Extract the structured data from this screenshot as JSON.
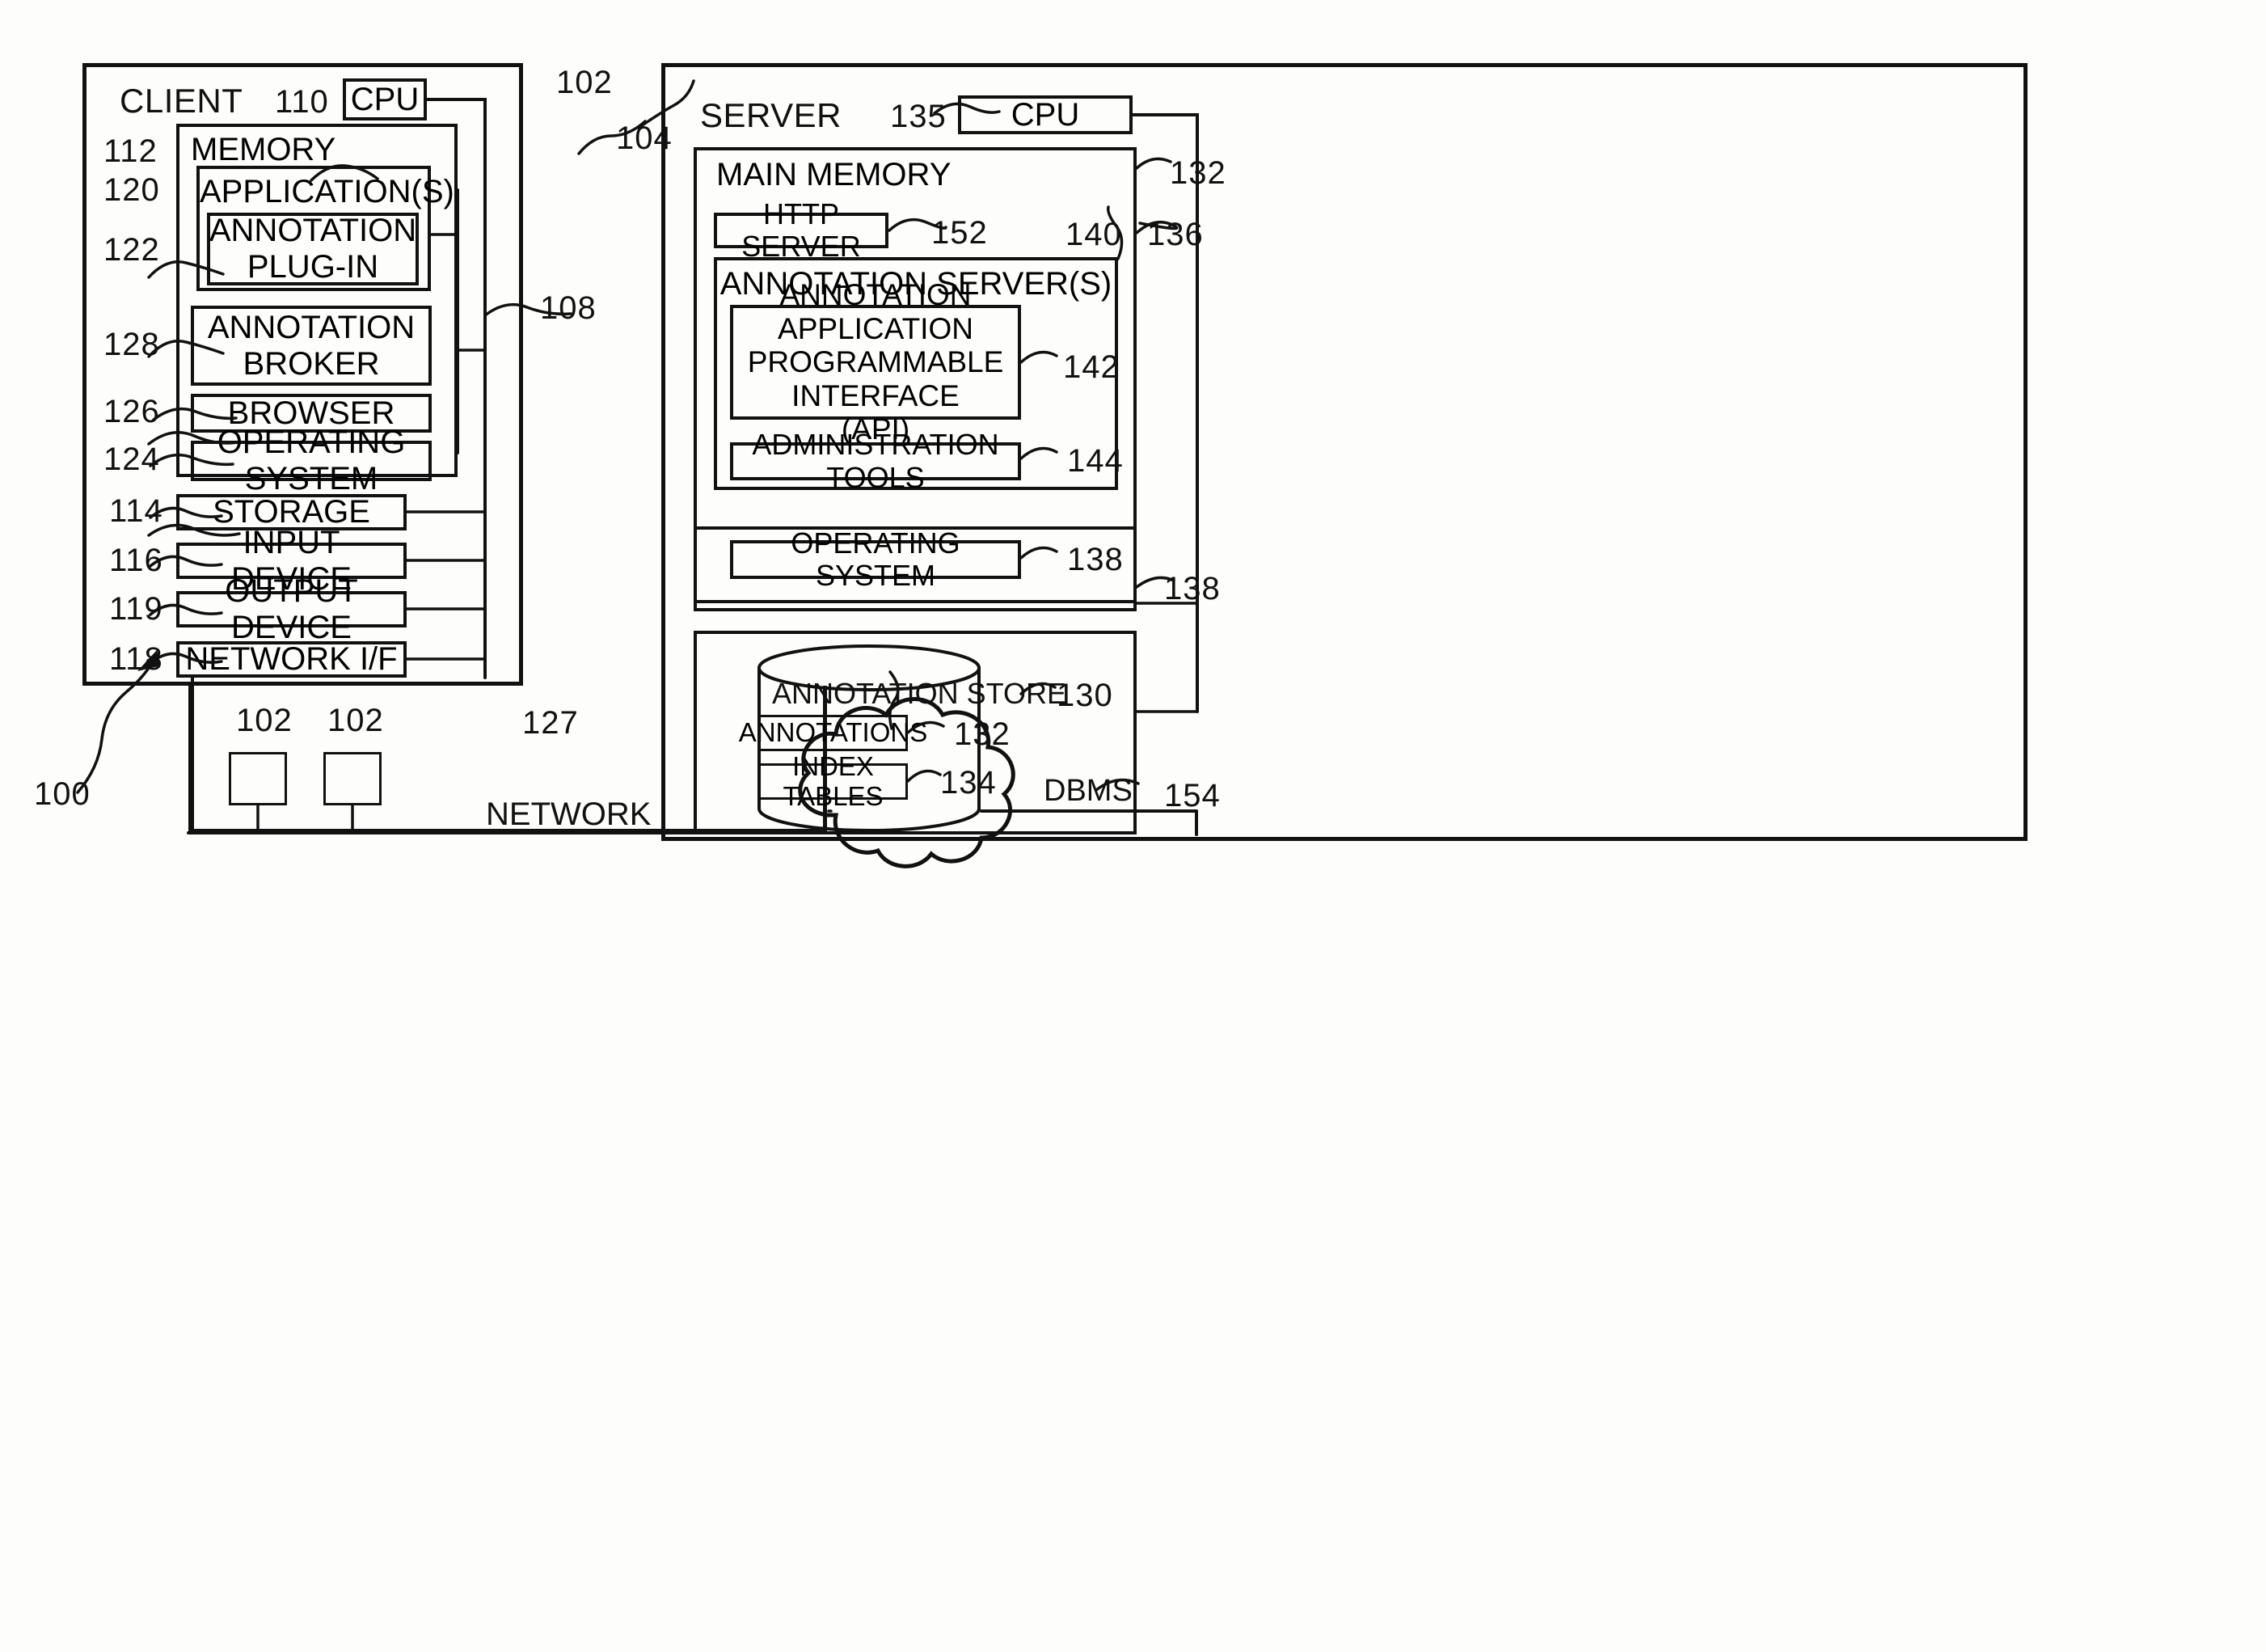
{
  "figure": {
    "system_ref": "100",
    "client": {
      "title": "CLIENT",
      "ref": "102",
      "bus_ref": "108",
      "cpu": {
        "label": "CPU",
        "ref": "110"
      },
      "memory": {
        "label": "MEMORY",
        "ref": "112"
      },
      "applications": {
        "label": "APPLICATION(S)",
        "ref": "120"
      },
      "annotation_plugin": {
        "line1": "ANNOTATION",
        "line2": "PLUG-IN",
        "ref": "122"
      },
      "annotation_broker": {
        "line1": "ANNOTATION",
        "line2": "BROKER",
        "ref": "128"
      },
      "browser": {
        "label": "BROWSER",
        "ref": "126"
      },
      "operating_system": {
        "label": "OPERATING SYSTEM",
        "ref": "124"
      },
      "storage": {
        "label": "STORAGE",
        "ref": "114"
      },
      "input_device": {
        "label": "INPUT DEVICE",
        "ref": "116"
      },
      "output_device": {
        "label": "OUTPUT DEVICE",
        "ref": "119"
      },
      "network_if": {
        "label": "NETWORK I/F",
        "ref": "118"
      }
    },
    "additional_clients": [
      {
        "ref": "102"
      },
      {
        "ref": "102"
      }
    ],
    "network": {
      "label": "NETWORK",
      "ref": "127"
    },
    "server": {
      "title": "SERVER",
      "ref": "104",
      "cpu": {
        "label": "CPU",
        "ref": "135"
      },
      "main_memory": {
        "label": "MAIN MEMORY",
        "ref": "132"
      },
      "bus_ref_upper": "136",
      "bus_ref_lower": "138",
      "http_server": {
        "label": "HTTP SERVER",
        "ref": "152"
      },
      "annotation_servers": {
        "label": "ANNOTATION SERVER(S)",
        "ref": "140"
      },
      "api": {
        "line1": "ANNOTATION APPLICATION",
        "line2": "PROGRAMMABLE INTERFACE",
        "line3": "(API)",
        "ref": "142"
      },
      "administration_tools": {
        "label": "ADMINISTRATION TOOLS",
        "ref": "144"
      },
      "operating_system": {
        "label": "OPERATING SYSTEM",
        "ref": "138"
      },
      "dbms": {
        "label": "DBMS",
        "ref": "154"
      },
      "annotation_store": {
        "label": "ANNOTATION STORE",
        "ref": "130"
      },
      "annotations": {
        "label": "ANNOTATIONS",
        "ref": "132"
      },
      "index_tables": {
        "label": "INDEX TABLES",
        "ref": "134"
      }
    }
  }
}
